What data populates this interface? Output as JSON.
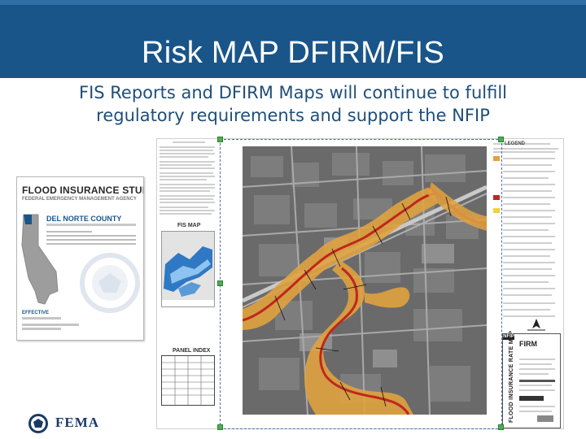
{
  "slide": {
    "title": "Risk MAP DFIRM/FIS",
    "subtitle_line1": "FIS Reports and DFIRM Maps will continue to fulfill",
    "subtitle_line2": "regulatory requirements and support the NFIP"
  },
  "fis_report": {
    "title": "FLOOD INSURANCE STUDY",
    "agency": "FEDERAL EMERGENCY MANAGEMENT AGENCY",
    "county": "DEL NORTE COUNTY",
    "effective_label": "EFFECTIVE"
  },
  "dfirm_map": {
    "index_label": "FIS MAP",
    "panel_label": "PANEL INDEX",
    "legend_heading": "LEGEND",
    "firm_tag": "NFIP",
    "firm_title": "FIRM",
    "firm_side_text": "FLOOD INSURANCE RATE MAP"
  },
  "logo": {
    "text": "FEMA"
  },
  "colors": {
    "header_blue": "#1a5589",
    "subtitle_blue": "#1f4e79",
    "floodplain_orange": "#e8a33a",
    "floodway_red": "#c0271c"
  }
}
